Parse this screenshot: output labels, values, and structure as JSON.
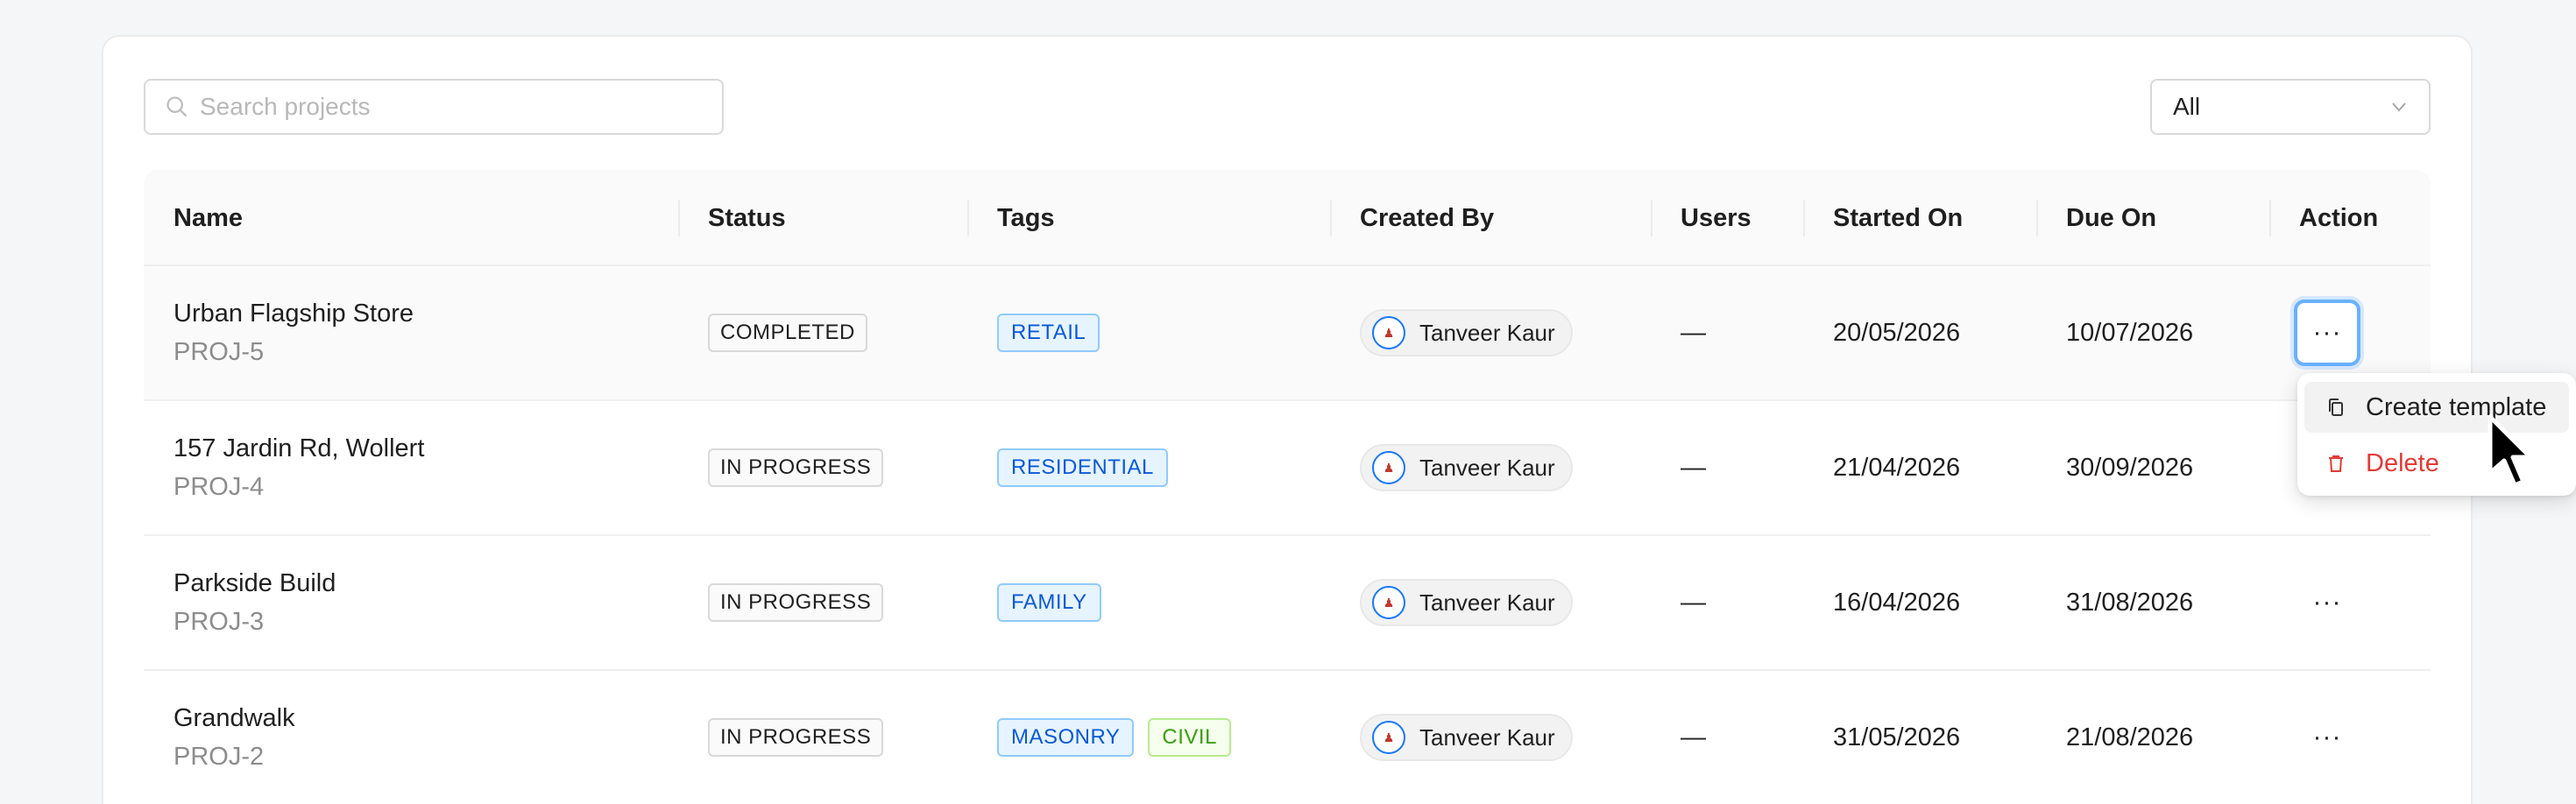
{
  "search": {
    "placeholder": "Search projects",
    "icon": "search-icon"
  },
  "filter": {
    "selected": "All",
    "icon": "chevron-down-icon"
  },
  "table": {
    "columns": [
      "Name",
      "Status",
      "Tags",
      "Created By",
      "Users",
      "Started On",
      "Due On",
      "Action"
    ],
    "rows": [
      {
        "name": "Urban Flagship Store",
        "code": "PROJ-5",
        "status": "COMPLETED",
        "tags": [
          "RETAIL"
        ],
        "created_by": "Tanveer Kaur",
        "users": "—",
        "started_on": "20/05/2026",
        "due_on": "10/07/2026",
        "action": "···"
      },
      {
        "name": "157 Jardin Rd, Wollert",
        "code": "PROJ-4",
        "status": "IN PROGRESS",
        "tags": [
          "RESIDENTIAL"
        ],
        "created_by": "Tanveer Kaur",
        "users": "—",
        "started_on": "21/04/2026",
        "due_on": "30/09/2026",
        "action": "···"
      },
      {
        "name": "Parkside Build",
        "code": "PROJ-3",
        "status": "IN PROGRESS",
        "tags": [
          "FAMILY"
        ],
        "created_by": "Tanveer Kaur",
        "users": "—",
        "started_on": "16/04/2026",
        "due_on": "31/08/2026",
        "action": "···"
      },
      {
        "name": "Grandwalk",
        "code": "PROJ-2",
        "status": "IN PROGRESS",
        "tags": [
          "MASONRY",
          "CIVIL"
        ],
        "created_by": "Tanveer Kaur",
        "users": "—",
        "started_on": "31/05/2026",
        "due_on": "21/08/2026",
        "action": "···"
      }
    ]
  },
  "dropdown_menu": {
    "items": [
      {
        "label": "Create template",
        "icon": "copy-icon"
      },
      {
        "label": "Delete",
        "icon": "trash-icon"
      }
    ]
  },
  "colors": {
    "accent": "#1677ff",
    "danger": "#e53935",
    "tag_blue": "#0958d9",
    "tag_green": "#389e0d"
  }
}
